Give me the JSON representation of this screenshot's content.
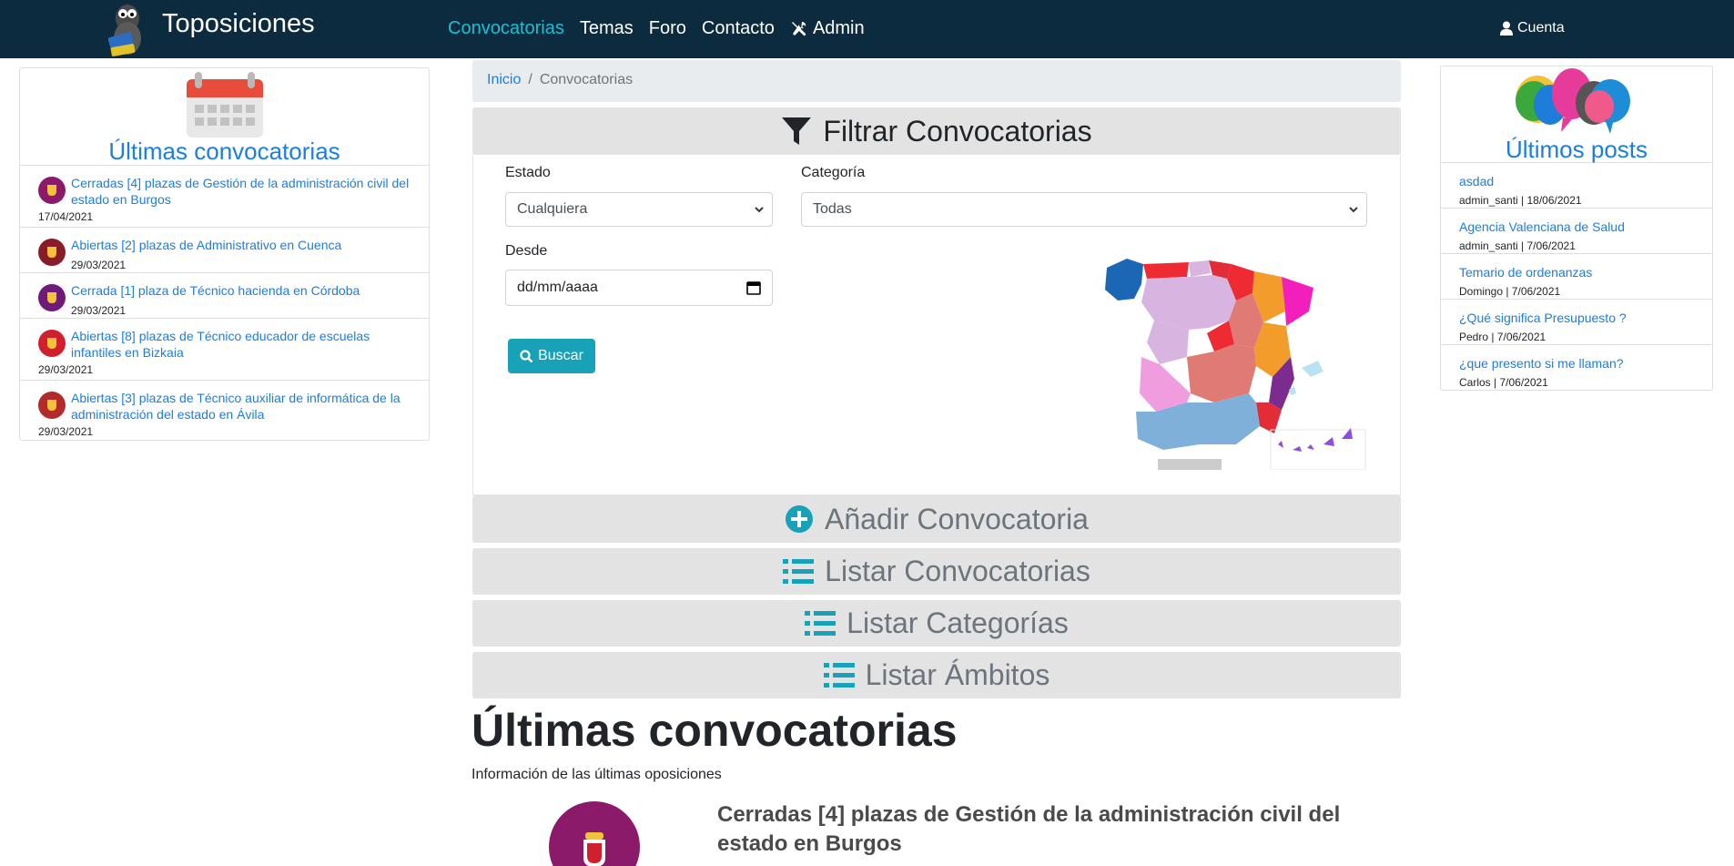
{
  "navbar": {
    "brand": "Toposiciones",
    "links": [
      {
        "label": "Convocatorias",
        "active": true
      },
      {
        "label": "Temas"
      },
      {
        "label": "Foro"
      },
      {
        "label": "Contacto"
      },
      {
        "label": "Admin",
        "icon": "tools-icon"
      }
    ],
    "account": "Cuenta"
  },
  "left": {
    "title": "Últimas convocatorias",
    "items": [
      {
        "text": "Cerradas [4] plazas de Gestión de la administración civil del estado en Burgos",
        "date": "17/04/2021",
        "color": "#8b1a6b"
      },
      {
        "text": "Abiertas [2] plazas de Administrativo en Cuenca",
        "date": "29/03/2021",
        "color": "#8a1c2a"
      },
      {
        "text": "Cerrada [1] plaza de Técnico hacienda en Córdoba",
        "date": "29/03/2021",
        "color": "#6d1a7a"
      },
      {
        "text": "Abiertas [8] plazas de Técnico educador de escuelas infantiles en Bizkaia",
        "date": "29/03/2021",
        "color": "#d21f2e"
      },
      {
        "text": "Abiertas [3] plazas de Técnico auxiliar de informática de la administración del estado en Ávila",
        "date": "29/03/2021",
        "color": "#b22a2a"
      }
    ]
  },
  "breadcrumb": {
    "home": "Inicio",
    "separator": "/",
    "current": "Convocatorias"
  },
  "filter": {
    "title": "Filtrar Convocatorias",
    "estado_label": "Estado",
    "estado_value": "Cualquiera",
    "categoria_label": "Categoría",
    "categoria_value": "Todas",
    "desde_label": "Desde",
    "desde_placeholder": "dd/mm/aaaa",
    "search_button": "Buscar"
  },
  "sections": {
    "add": "Añadir Convocatoria",
    "list_conv": "Listar Convocatorias",
    "list_cat": "Listar Categorías",
    "list_amb": "Listar Ámbitos"
  },
  "main": {
    "title": "Últimas convocatorias",
    "subtitle": "Información de las últimas oposiciones",
    "first_item_title": "Cerradas [4] plazas de Gestión de la administración civil del estado en Burgos"
  },
  "right": {
    "title": "Últimos posts",
    "posts": [
      {
        "title": "asdad",
        "meta": "admin_santi | 18/06/2021"
      },
      {
        "title": "Agencia Valenciana de Salud",
        "meta": "admin_santi | 7/06/2021"
      },
      {
        "title": "Temario de ordenanzas",
        "meta": "Domingo | 7/06/2021"
      },
      {
        "title": "¿Qué significa Presupuesto ?",
        "meta": "Pedro | 7/06/2021"
      },
      {
        "title": "¿que presento si me llaman?",
        "meta": "Carlos | 7/06/2021"
      }
    ]
  },
  "colors": {
    "accent": "#17a2b8",
    "link": "#1a7ee3",
    "navbar": "#0d2b3e"
  }
}
